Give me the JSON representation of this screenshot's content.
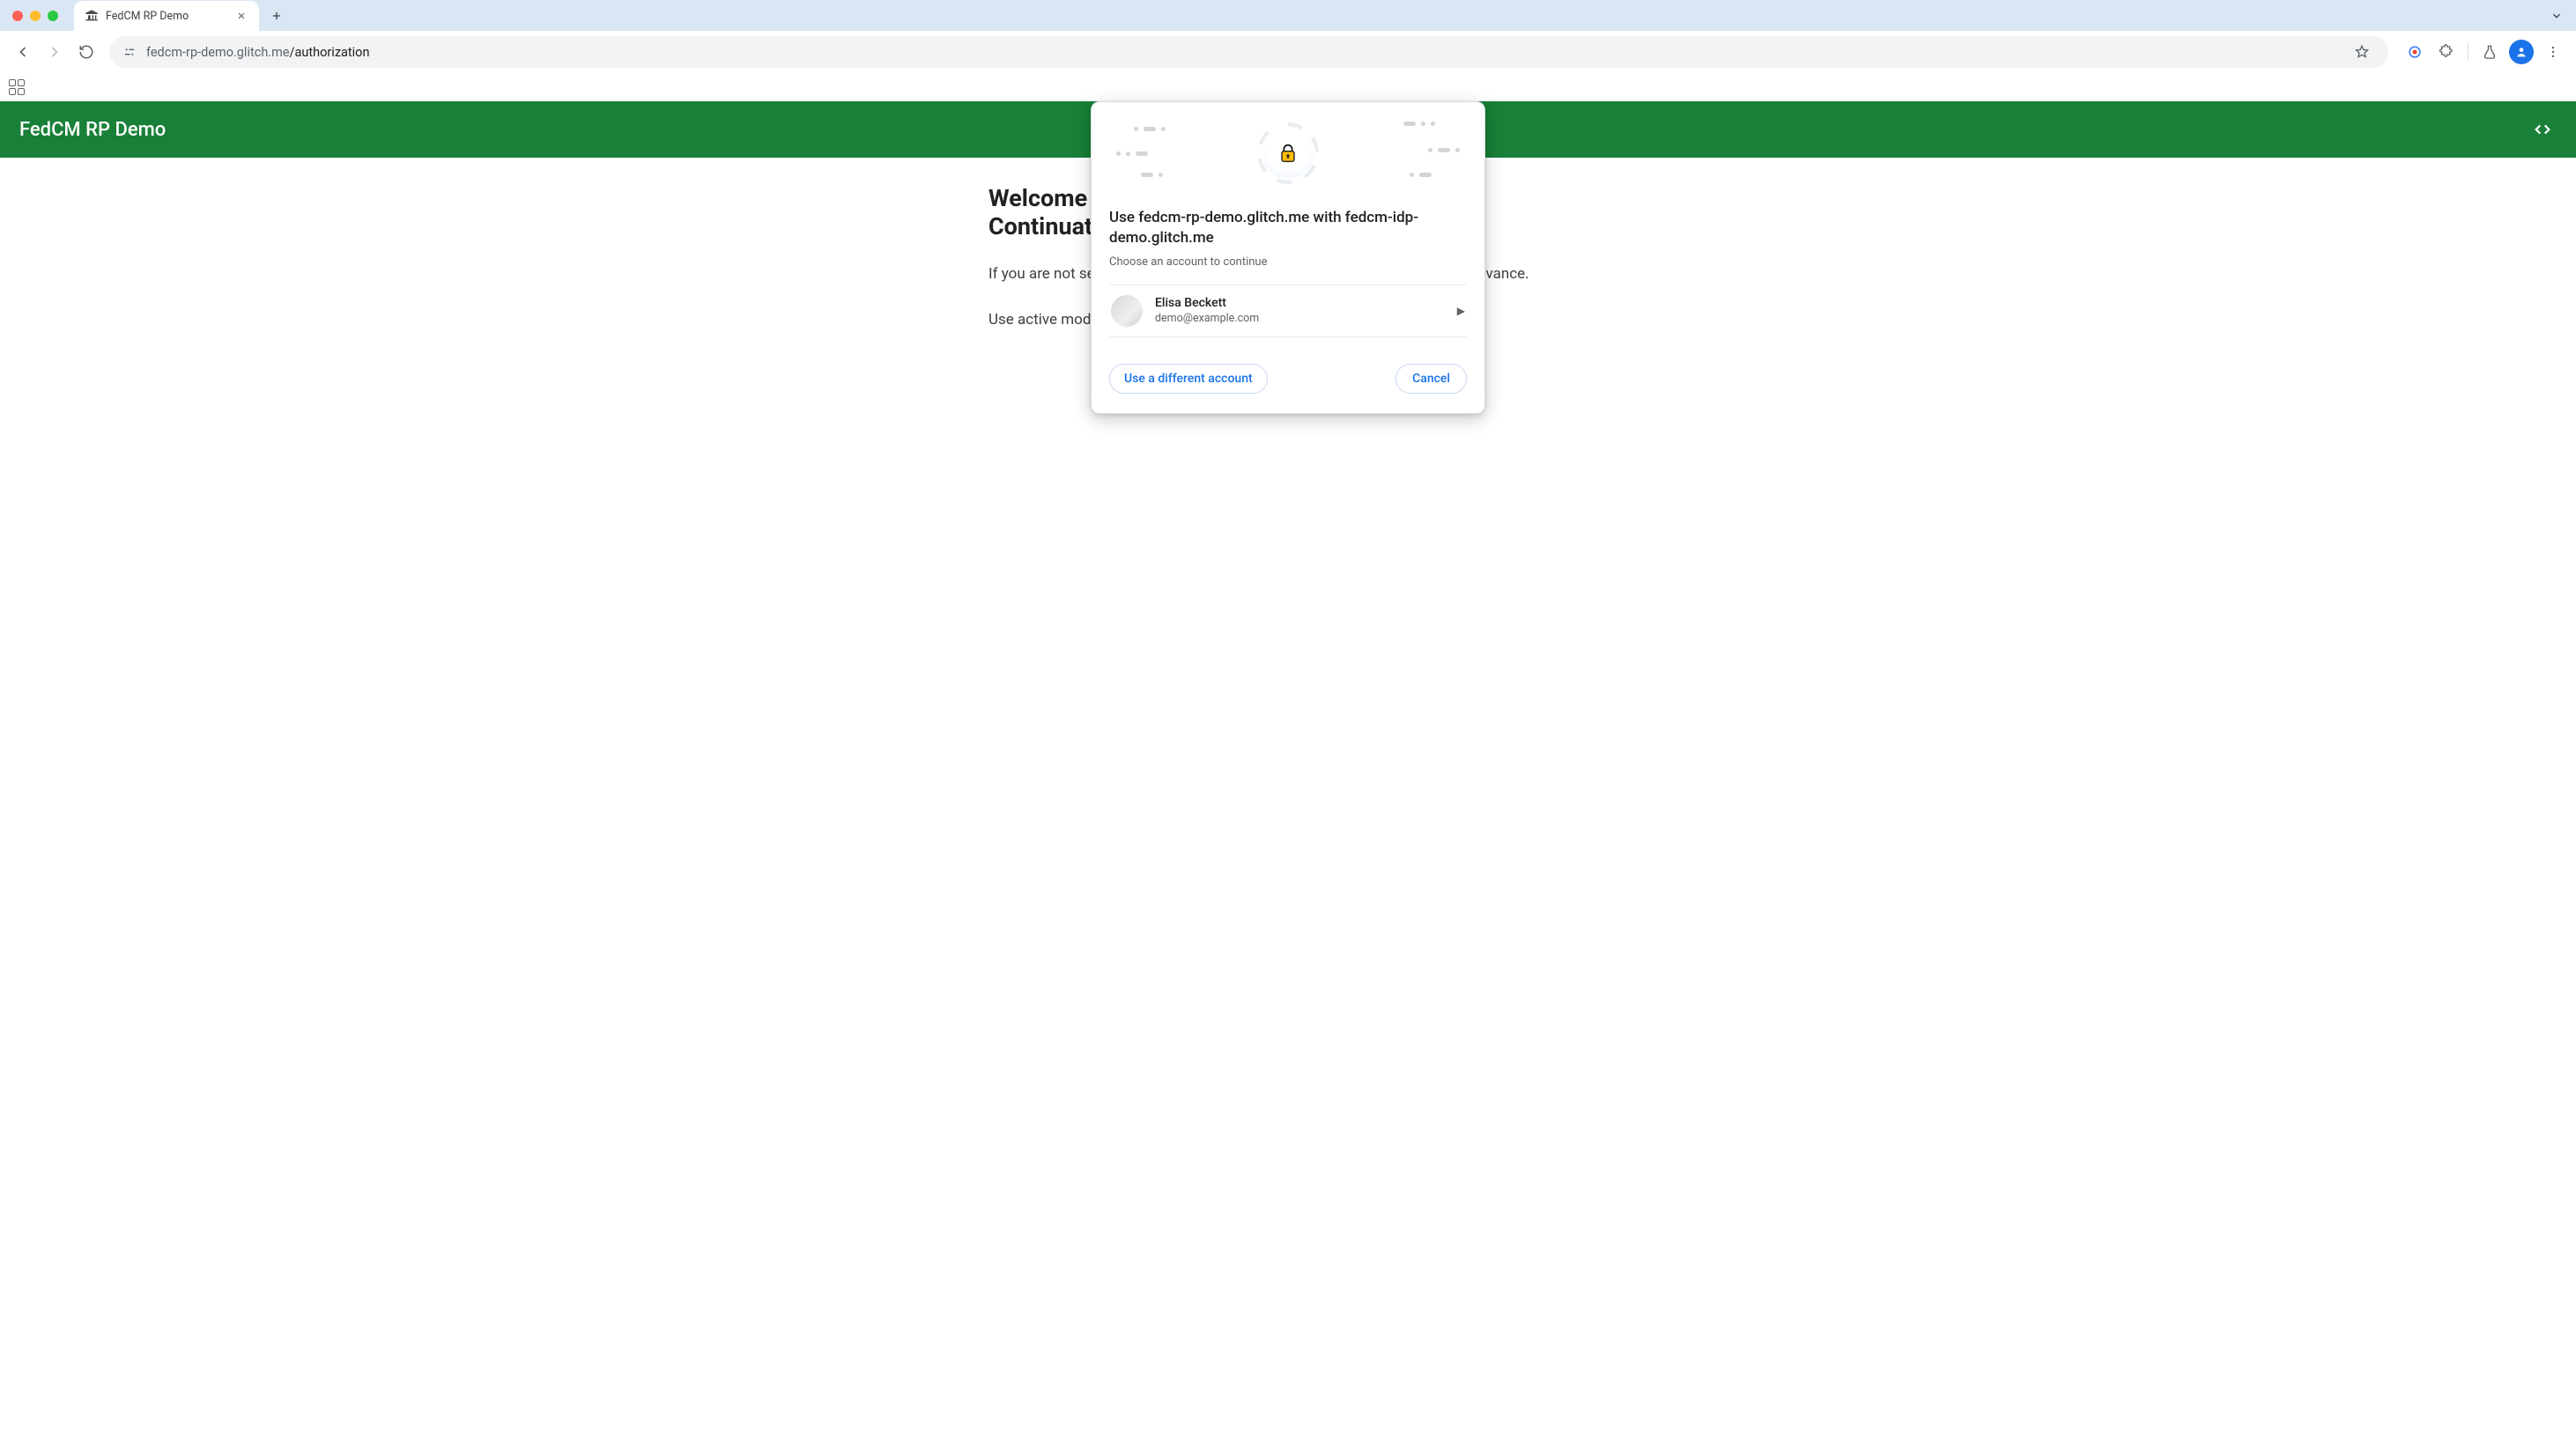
{
  "browser": {
    "tab_title": "FedCM RP Demo",
    "url": {
      "host": "fedcm-rp-demo.glitch.me",
      "path": "/authorization"
    }
  },
  "app": {
    "title": "FedCM RP Demo"
  },
  "content": {
    "heading_line1": "Welcome to FedCM RP Demo!",
    "heading_line2": "Continuation API",
    "paragraph1": "If you are not seeing a dialog, enable FedCM and try sign-in on the IdP in advance.",
    "paragraph2": "Use active mode behind a flag to display a login dialog."
  },
  "modal": {
    "title": "Use fedcm-rp-demo.glitch.me with fedcm-idp-demo.glitch.me",
    "subtitle": "Choose an account to continue",
    "account": {
      "name": "Elisa Beckett",
      "email": "demo@example.com"
    },
    "use_different": "Use a different account",
    "cancel": "Cancel"
  }
}
